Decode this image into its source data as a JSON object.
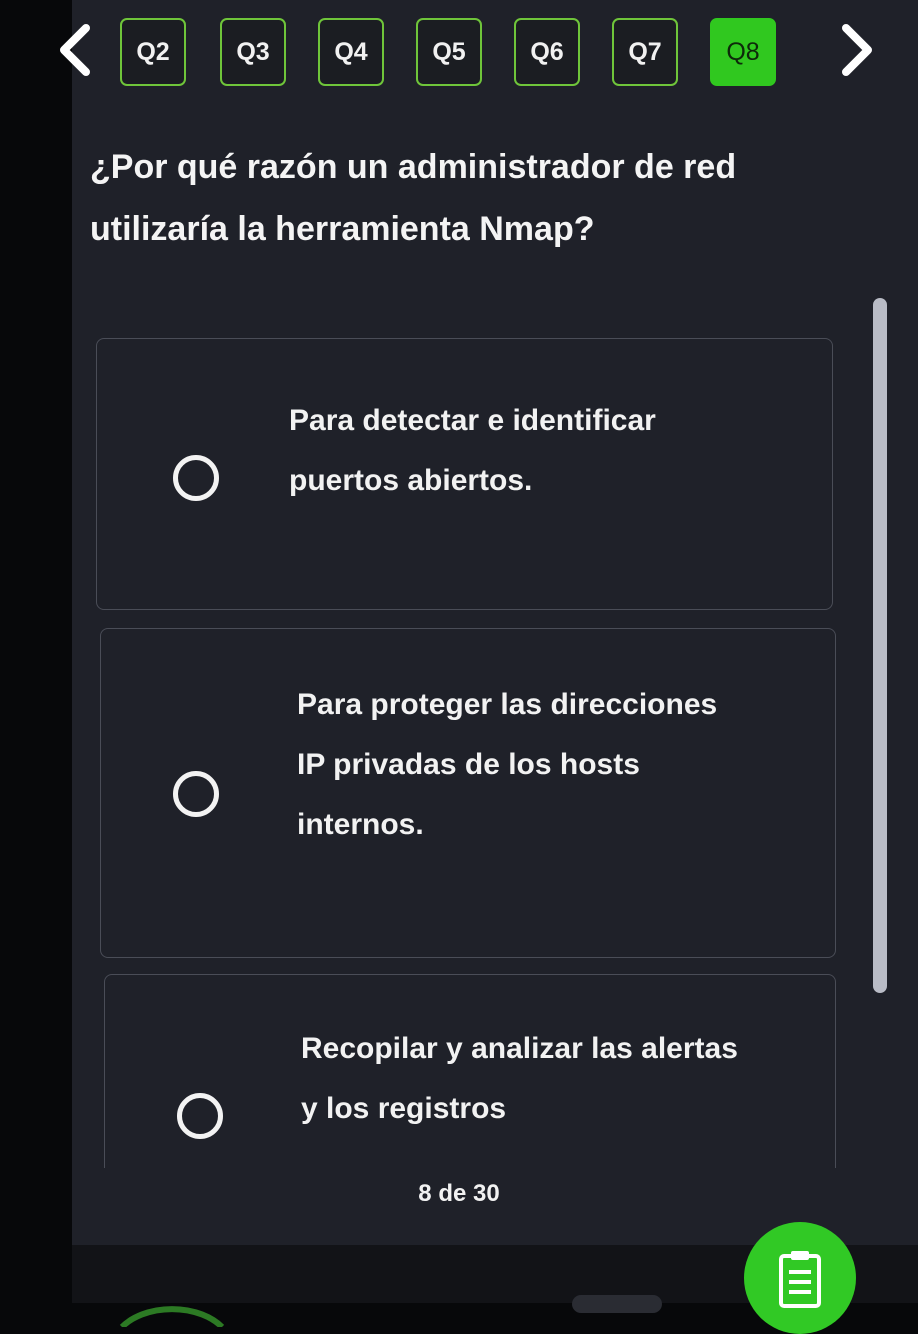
{
  "navigation": {
    "prev_icon": "chevron-left-icon",
    "next_icon": "chevron-right-icon",
    "questions": [
      {
        "label": "Q2",
        "active": false
      },
      {
        "label": "Q3",
        "active": false
      },
      {
        "label": "Q4",
        "active": false
      },
      {
        "label": "Q5",
        "active": false
      },
      {
        "label": "Q6",
        "active": false
      },
      {
        "label": "Q7",
        "active": false
      },
      {
        "label": "Q8",
        "active": true
      }
    ],
    "accent_color": "#30c81f"
  },
  "question": {
    "text": "¿Por qué razón un administrador de red utilizaría la herramienta Nmap?"
  },
  "options": [
    {
      "text": "Para detectar e identificar puertos abiertos.",
      "selected": false
    },
    {
      "text": "Para proteger las direcciones IP privadas de los hosts internos.",
      "selected": false
    },
    {
      "text": "Recopilar y analizar las alertas y los registros",
      "selected": false
    }
  ],
  "progress": {
    "counter_text": "8 de 30"
  },
  "actions": {
    "notes_icon": "clipboard-list-icon",
    "notes_color": "#31c925"
  }
}
